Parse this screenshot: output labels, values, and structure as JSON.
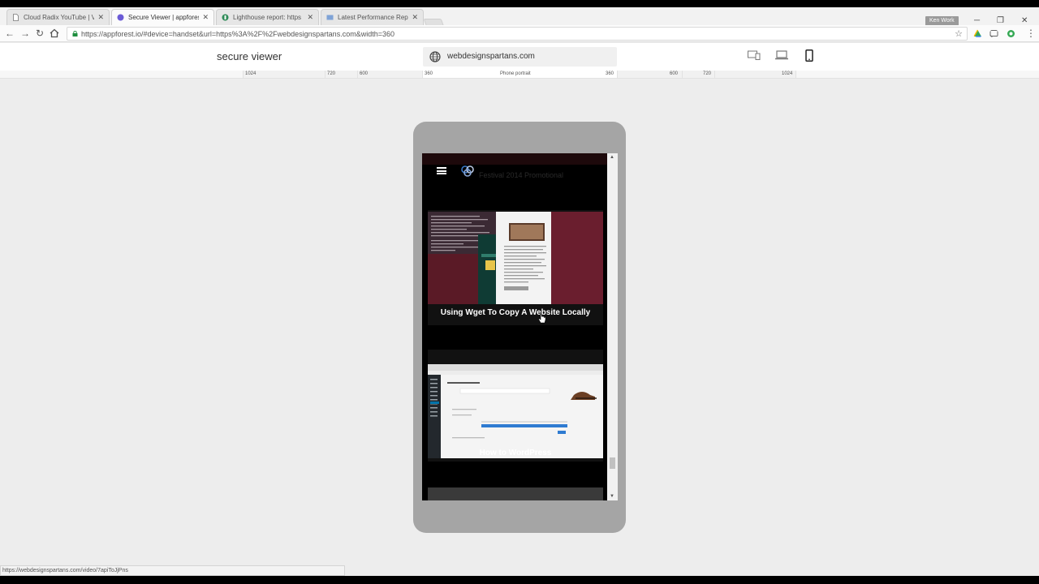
{
  "browser": {
    "tabs": [
      {
        "title": "Cloud Radix YouTube | V",
        "icon": "page-icon",
        "active": false
      },
      {
        "title": "Secure Viewer | appfores",
        "icon": "appforest-icon",
        "active": true
      },
      {
        "title": "Lighthouse report: https",
        "icon": "lighthouse-icon",
        "active": false
      },
      {
        "title": "Latest Performance Repo",
        "icon": "gtmetrix-icon",
        "active": false
      }
    ],
    "profile_name": "Ken Work",
    "url": "https://appforest.io/#device=handset&url=https%3A%2F%2Fwebdesignspartans.com&width=360",
    "status_url": "https://webdesignspartans.com/video/7apiToJjPns"
  },
  "app": {
    "brand": "secure viewer",
    "site": "webdesignspartans.com",
    "device_icons": [
      "responsive-icon",
      "laptop-icon",
      "phone-icon"
    ],
    "active_device": "phone-icon"
  },
  "ruler": {
    "labels_left": [
      "1024",
      "720",
      "600",
      "360"
    ],
    "center_label": "Phone portrait",
    "labels_right": [
      "360",
      "600",
      "720",
      "1024"
    ]
  },
  "site": {
    "header_ghost_text": "Festival 2014 Promotional",
    "videos": [
      {
        "title": "Using Wget To Copy A Website Locally"
      },
      {
        "title": "How to WordPress"
      }
    ]
  },
  "colors": {
    "accent": "#1a73e8",
    "phone_frame": "#a5a5a5",
    "page_bg": "#ededed"
  }
}
